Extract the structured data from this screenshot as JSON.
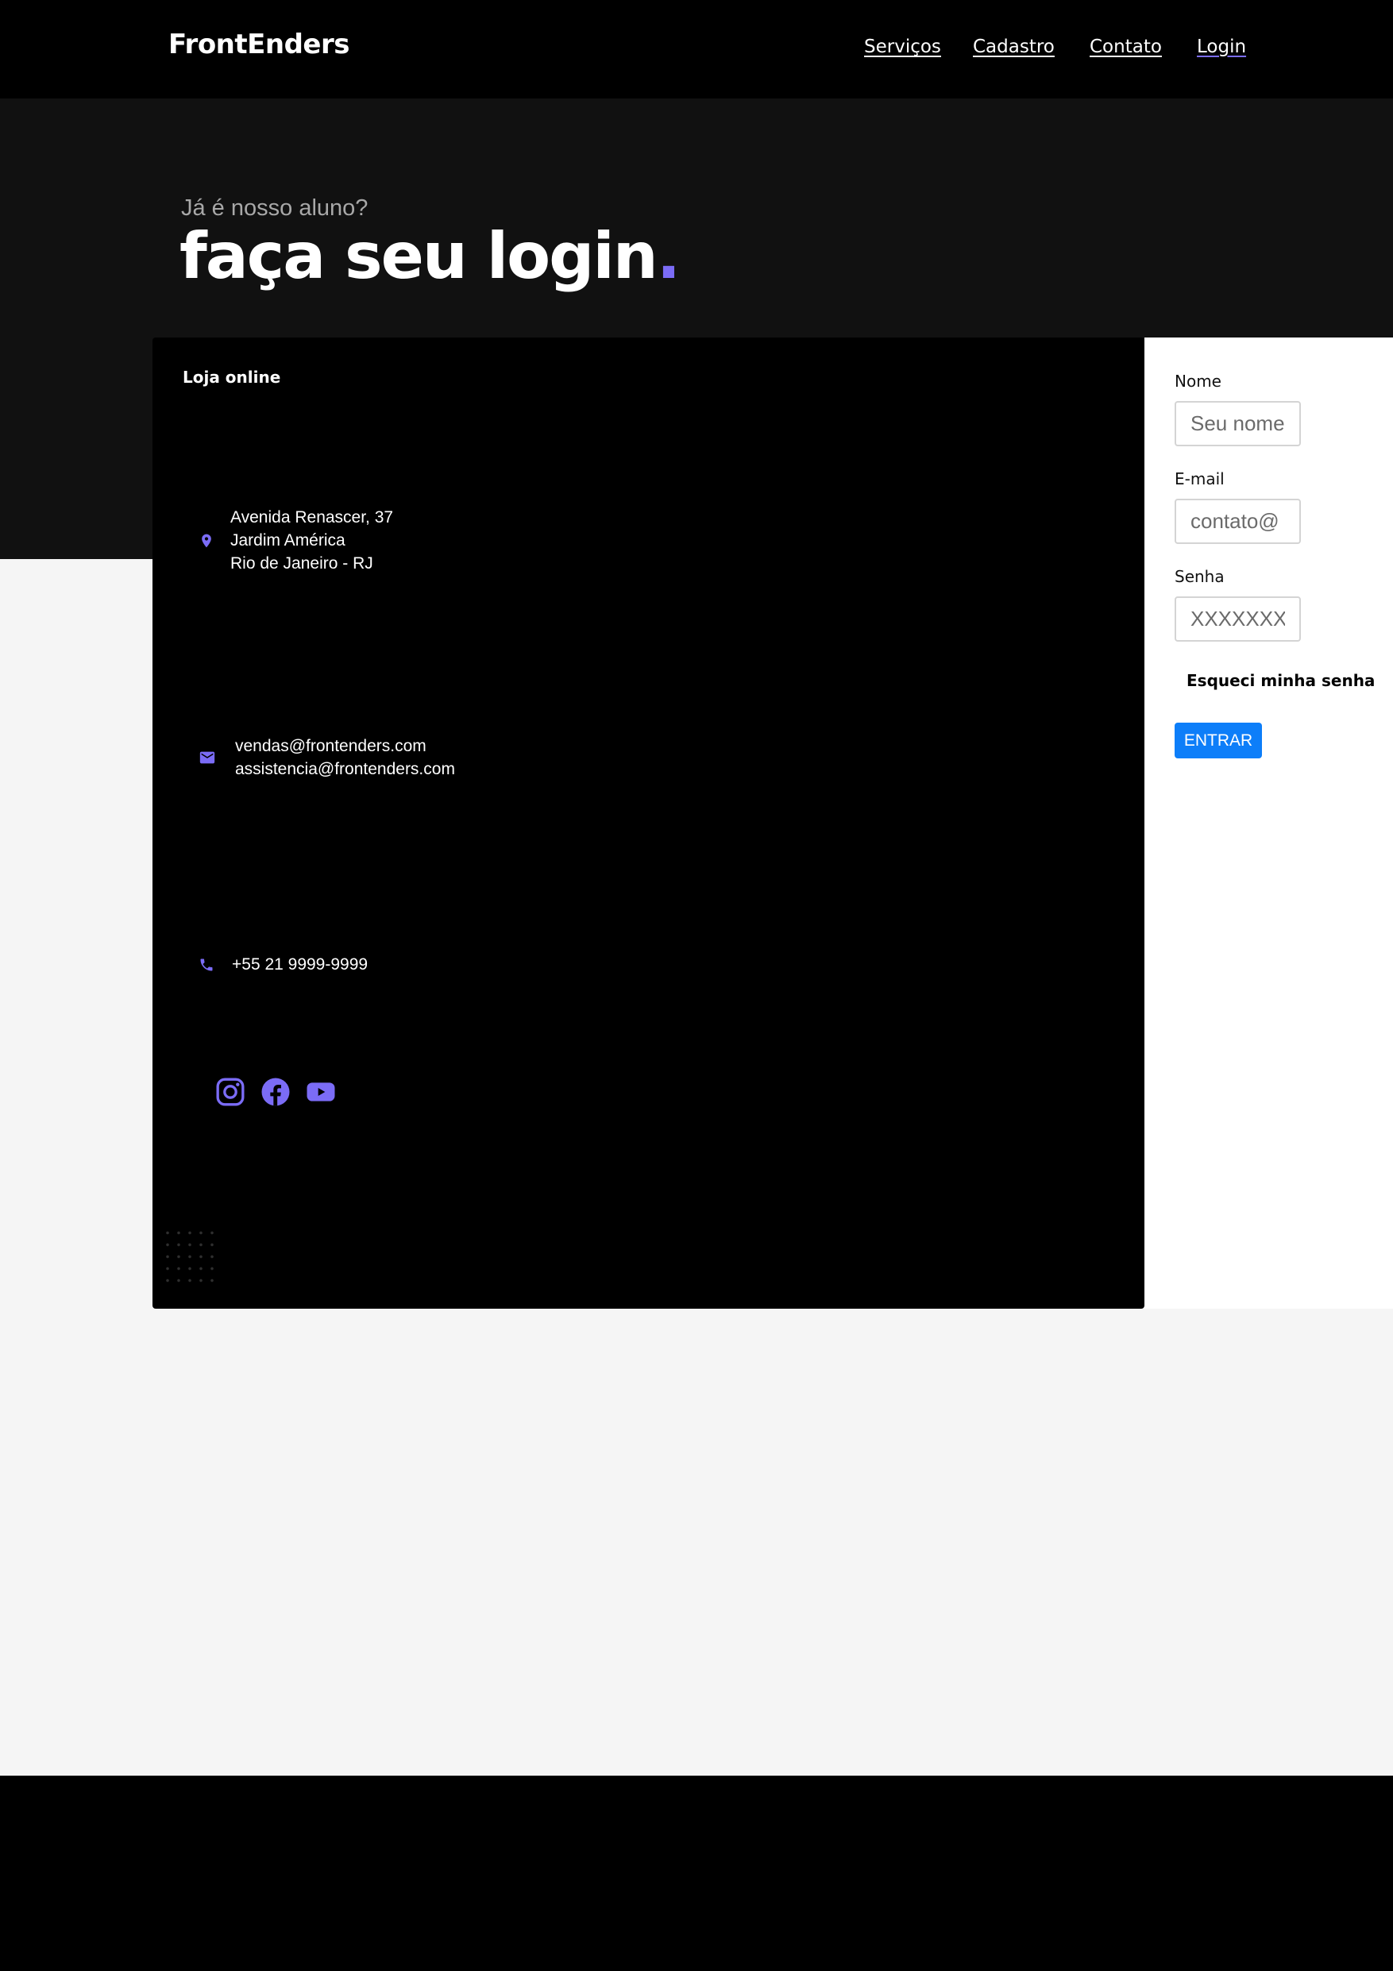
{
  "header": {
    "brand": "FrontEnders",
    "nav": [
      {
        "label": "Serviços",
        "active": false
      },
      {
        "label": "Cadastro",
        "active": false
      },
      {
        "label": "Contato",
        "active": false
      },
      {
        "label": "Login",
        "active": true
      }
    ]
  },
  "hero": {
    "subtitle": "Já é nosso aluno?",
    "title": "faça seu login",
    "title_dot": "."
  },
  "info": {
    "title": "Loja online",
    "address": {
      "icon": "location-pin-icon",
      "lines": [
        "Avenida Renascer, 37",
        "Jardim América",
        "Rio de Janeiro - RJ"
      ]
    },
    "email": {
      "icon": "mail-icon",
      "lines": [
        "vendas@frontenders.com",
        "assistencia@frontenders.com"
      ]
    },
    "phone": {
      "icon": "phone-icon",
      "text": "+55 21 9999-9999"
    },
    "socials": [
      "instagram-icon",
      "facebook-icon",
      "youtube-icon"
    ]
  },
  "form": {
    "nome": {
      "label": "Nome",
      "placeholder": "Seu nome"
    },
    "email": {
      "label": "E-mail",
      "placeholder": "contato@"
    },
    "senha": {
      "label": "Senha",
      "placeholder": "XXXXXXXX"
    },
    "forgot": "Esqueci minha senha",
    "submit": "ENTRAR"
  },
  "colors": {
    "accent": "#7b6cf6",
    "button": "#0d7ef9",
    "navbar": "#000000",
    "hero": "#111111",
    "page": "#f5f5f5"
  }
}
